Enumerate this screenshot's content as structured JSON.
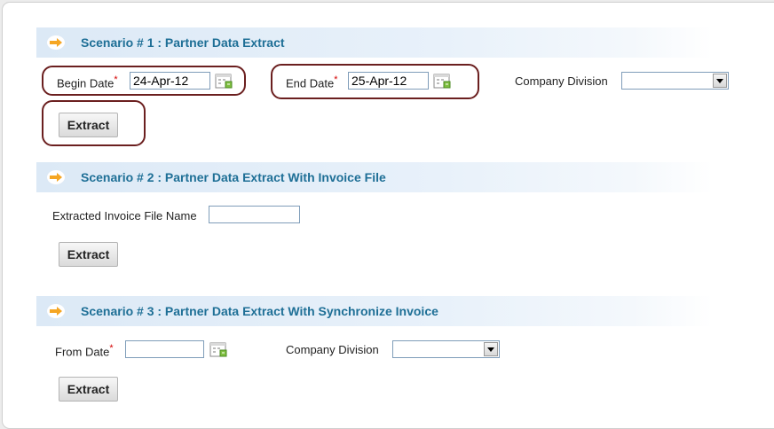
{
  "scenario1": {
    "title": "Scenario # 1 : Partner Data Extract",
    "begin_date_label": "Begin Date",
    "begin_date_value": "24-Apr-12",
    "end_date_label": "End Date",
    "end_date_value": "25-Apr-12",
    "company_division_label": "Company Division",
    "company_division_value": "",
    "extract_label": "Extract"
  },
  "scenario2": {
    "title": "Scenario # 2 : Partner Data Extract With Invoice File",
    "invoice_file_label": "Extracted Invoice File Name",
    "invoice_file_value": "",
    "extract_label": "Extract"
  },
  "scenario3": {
    "title": "Scenario # 3 : Partner Data Extract With Synchronize Invoice",
    "from_date_label": "From Date",
    "from_date_value": "",
    "company_division_label": "Company Division",
    "company_division_value": "",
    "extract_label": "Extract"
  },
  "required_mark": "*",
  "colors": {
    "header_text": "#1e6f96",
    "header_band": "#dce9f6",
    "arrow": "#f5a623",
    "required": "#d40000",
    "highlight_border": "#6b1f1f"
  },
  "icons": {
    "section_arrow": "arrow-right-icon",
    "date_picker": "calendar-icon"
  }
}
